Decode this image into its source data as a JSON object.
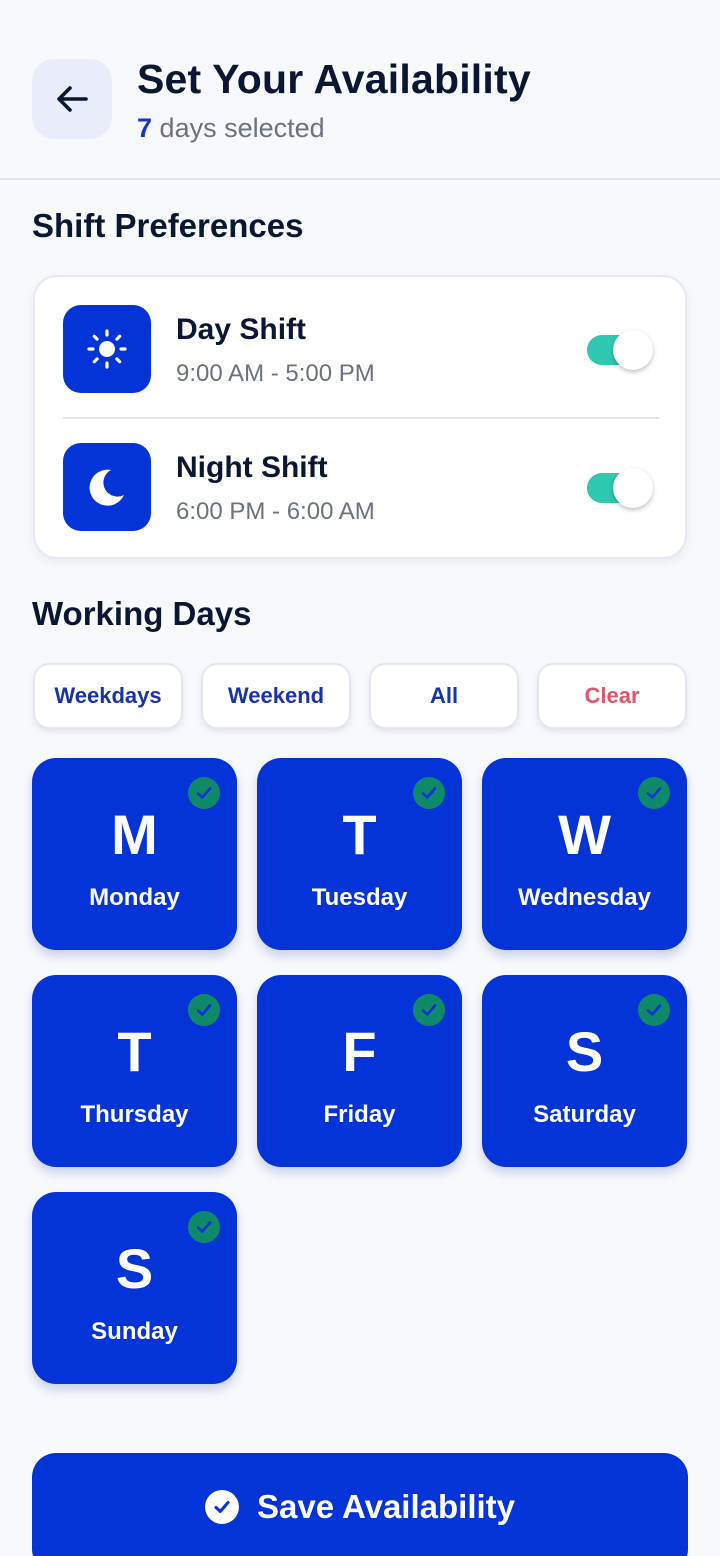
{
  "header": {
    "title": "Set Your Availability",
    "selected_count": "7",
    "selected_suffix": "days selected"
  },
  "shift_preferences": {
    "title": "Shift Preferences",
    "shifts": [
      {
        "name": "Day Shift",
        "time": "9:00 AM - 5:00 PM",
        "icon": "sun-icon",
        "enabled": true
      },
      {
        "name": "Night Shift",
        "time": "6:00 PM - 6:00 AM",
        "icon": "moon-icon",
        "enabled": true
      }
    ]
  },
  "working_days": {
    "title": "Working Days",
    "quick_buttons": [
      "Weekdays",
      "Weekend",
      "All",
      "Clear"
    ],
    "days": [
      {
        "letter": "M",
        "name": "Monday",
        "selected": true
      },
      {
        "letter": "T",
        "name": "Tuesday",
        "selected": true
      },
      {
        "letter": "W",
        "name": "Wednesday",
        "selected": true
      },
      {
        "letter": "T",
        "name": "Thursday",
        "selected": true
      },
      {
        "letter": "F",
        "name": "Friday",
        "selected": true
      },
      {
        "letter": "S",
        "name": "Saturday",
        "selected": true
      },
      {
        "letter": "S",
        "name": "Sunday",
        "selected": true
      }
    ]
  },
  "save_button": {
    "label": "Save Availability",
    "icon": "check-circle-icon"
  },
  "colors": {
    "primary": "#0433d8",
    "toggle_on": "#2ec9b0",
    "check_badge": "#0e8a6a",
    "clear": "#e05569",
    "background": "#f7f9fd"
  }
}
